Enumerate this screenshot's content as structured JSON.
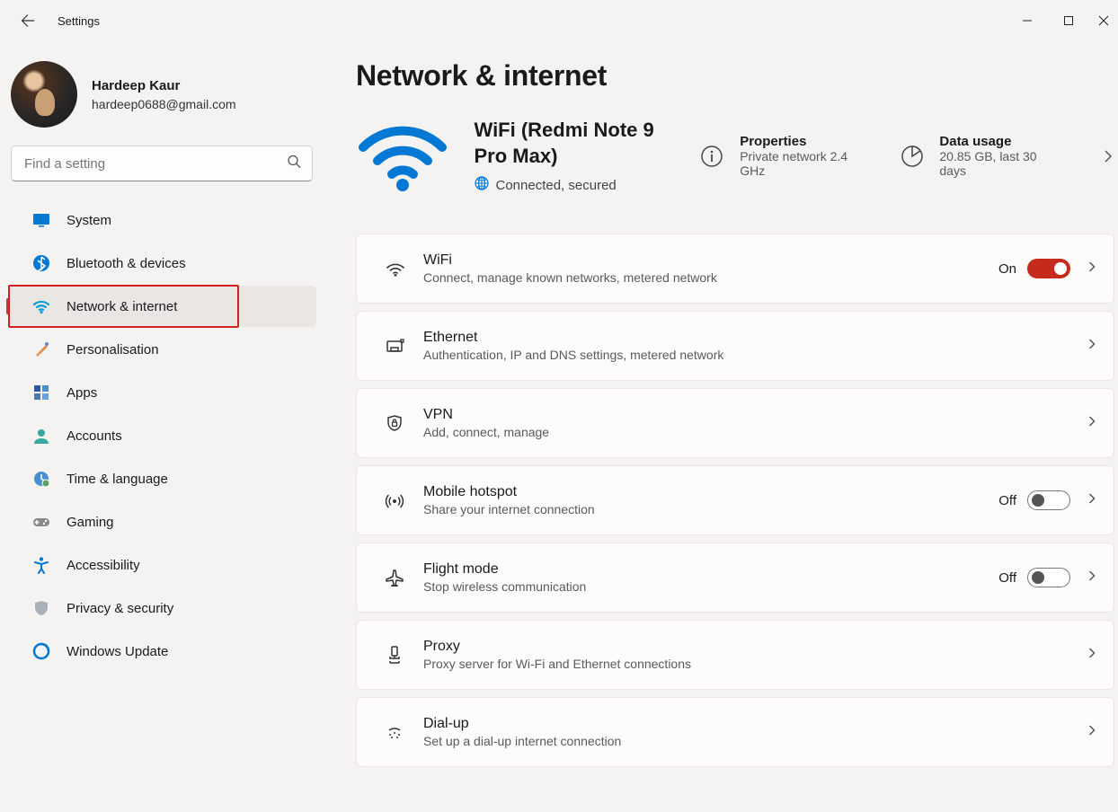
{
  "app": {
    "title": "Settings"
  },
  "profile": {
    "name": "Hardeep Kaur",
    "email": "hardeep0688@gmail.com"
  },
  "search": {
    "placeholder": "Find a setting"
  },
  "sidebar": {
    "items": [
      {
        "label": "System",
        "icon": "display"
      },
      {
        "label": "Bluetooth & devices",
        "icon": "bluetooth"
      },
      {
        "label": "Network & internet",
        "icon": "wifi",
        "selected": true
      },
      {
        "label": "Personalisation",
        "icon": "brush"
      },
      {
        "label": "Apps",
        "icon": "apps"
      },
      {
        "label": "Accounts",
        "icon": "person"
      },
      {
        "label": "Time & language",
        "icon": "clock"
      },
      {
        "label": "Gaming",
        "icon": "gamepad"
      },
      {
        "label": "Accessibility",
        "icon": "accessibility"
      },
      {
        "label": "Privacy & security",
        "icon": "shield"
      },
      {
        "label": "Windows Update",
        "icon": "update"
      }
    ]
  },
  "page": {
    "title": "Network & internet",
    "wifi": {
      "name": "WiFi (Redmi Note 9 Pro Max)",
      "status": "Connected, secured"
    },
    "tiles": {
      "properties": {
        "title": "Properties",
        "sub": "Private network 2.4 GHz"
      },
      "data_usage": {
        "title": "Data usage",
        "sub": "20.85 GB, last 30 days"
      }
    },
    "cards": [
      {
        "title": "WiFi",
        "sub": "Connect, manage known networks, metered network",
        "icon": "wifi",
        "toggle": "On"
      },
      {
        "title": "Ethernet",
        "sub": "Authentication, IP and DNS settings, metered network",
        "icon": "ethernet"
      },
      {
        "title": "VPN",
        "sub": "Add, connect, manage",
        "icon": "vpn"
      },
      {
        "title": "Mobile hotspot",
        "sub": "Share your internet connection",
        "icon": "hotspot",
        "toggle": "Off"
      },
      {
        "title": "Flight mode",
        "sub": "Stop wireless communication",
        "icon": "airplane",
        "toggle": "Off"
      },
      {
        "title": "Proxy",
        "sub": "Proxy server for Wi-Fi and Ethernet connections",
        "icon": "proxy"
      },
      {
        "title": "Dial-up",
        "sub": "Set up a dial-up internet connection",
        "icon": "dialup"
      }
    ]
  }
}
